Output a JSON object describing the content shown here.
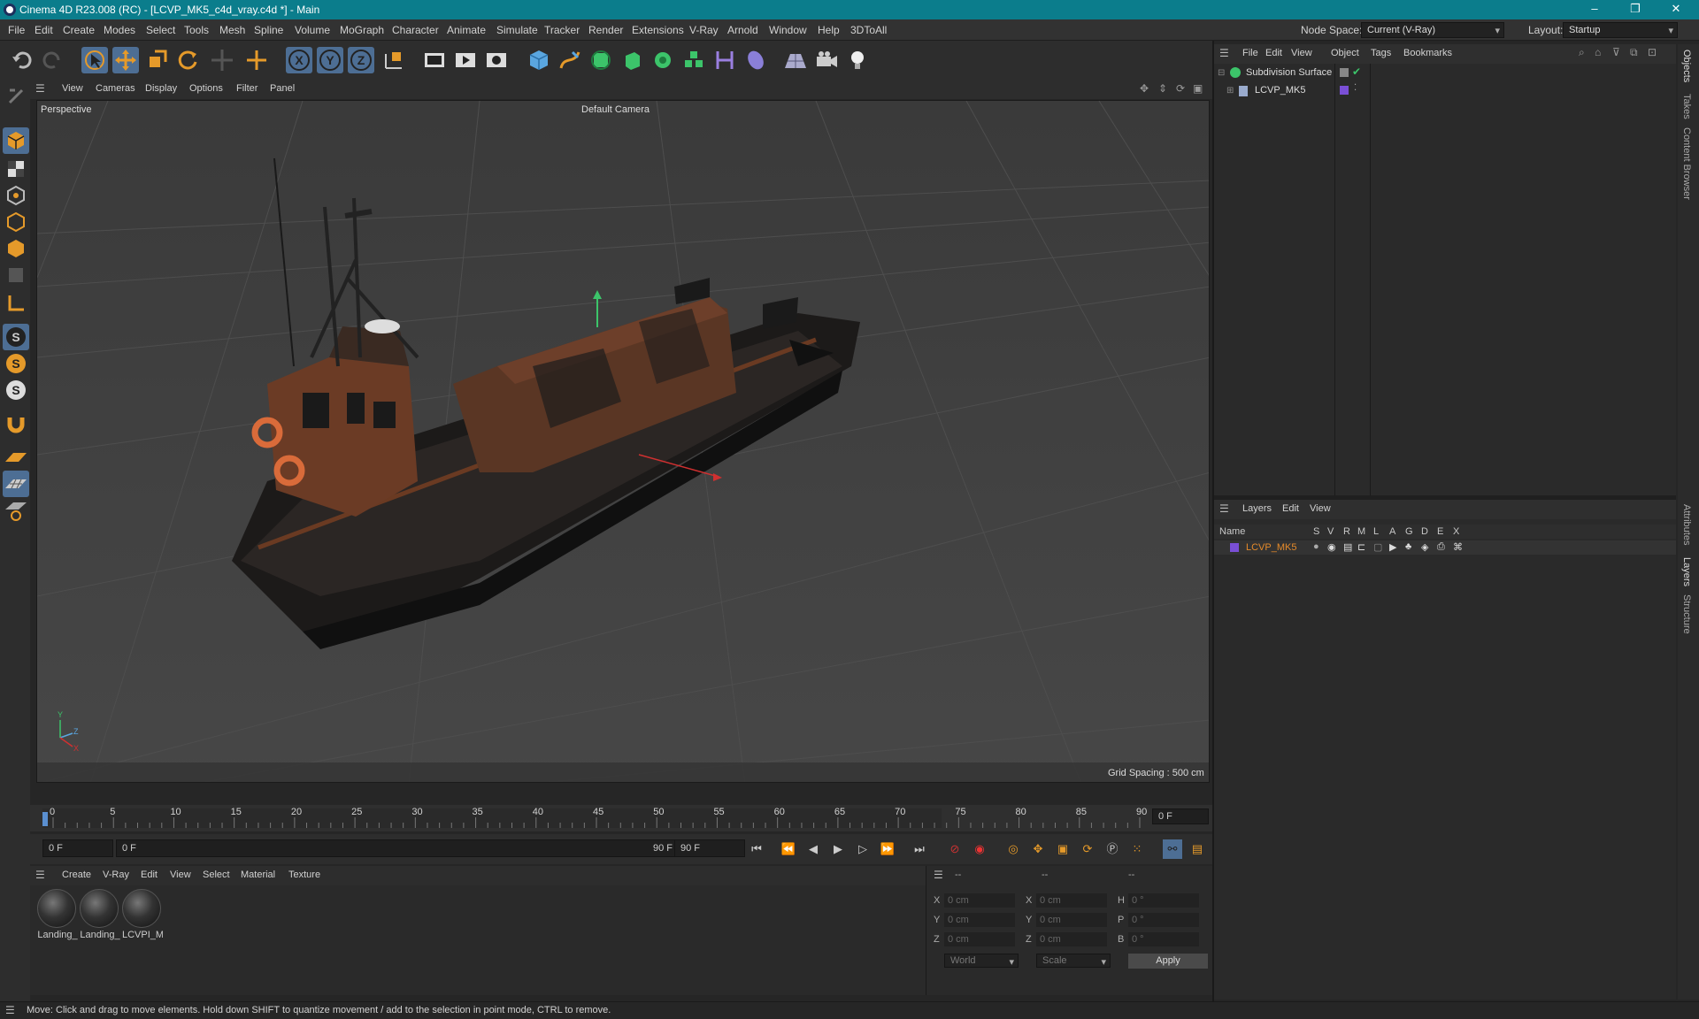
{
  "window": {
    "title": "Cinema 4D R23.008 (RC) - [LCVP_MK5_c4d_vray.c4d *] - Main"
  },
  "menu": [
    "File",
    "Edit",
    "Create",
    "Modes",
    "Select",
    "Tools",
    "Mesh",
    "Spline",
    "Volume",
    "MoGraph",
    "Character",
    "Animate",
    "Simulate",
    "Tracker",
    "Render",
    "Extensions",
    "V-Ray",
    "Arnold",
    "Window",
    "Help",
    "3DToAll"
  ],
  "node_space": {
    "label": "Node Space:",
    "value": "Current (V-Ray)"
  },
  "layout": {
    "label": "Layout:",
    "value": "Startup"
  },
  "viewport": {
    "menu": [
      "View",
      "Cameras",
      "Display",
      "Options",
      "Filter",
      "Panel"
    ],
    "name": "Perspective",
    "camera": "Default Camera",
    "grid_spacing": "Grid Spacing : 500 cm"
  },
  "timeline": {
    "ticks": [
      "0",
      "5",
      "10",
      "15",
      "20",
      "25",
      "30",
      "35",
      "40",
      "45",
      "50",
      "55",
      "60",
      "65",
      "70",
      "75",
      "80",
      "85",
      "90"
    ],
    "current_frame": "0 F",
    "start_field": "0 F",
    "range_start": "0 F",
    "range_end": "90 F",
    "end_field": "90 F"
  },
  "material_manager": {
    "menu": [
      "Create",
      "V-Ray",
      "Edit",
      "View",
      "Select",
      "Material",
      "Texture"
    ],
    "materials": [
      "Landing_",
      "Landing_",
      "LCVPI_M"
    ]
  },
  "coordinates": {
    "headers": [
      "--",
      "--",
      "--"
    ],
    "rows": [
      {
        "a": "X",
        "av": "0 cm",
        "b": "X",
        "bv": "0 cm",
        "c": "H",
        "cv": "0 °"
      },
      {
        "a": "Y",
        "av": "0 cm",
        "b": "Y",
        "bv": "0 cm",
        "c": "P",
        "cv": "0 °"
      },
      {
        "a": "Z",
        "av": "0 cm",
        "b": "Z",
        "bv": "0 cm",
        "c": "B",
        "cv": "0 °"
      }
    ],
    "space": "World",
    "mode": "Scale",
    "apply": "Apply"
  },
  "object_manager": {
    "menu": [
      "File",
      "Edit",
      "View",
      "Object",
      "Tags",
      "Bookmarks"
    ],
    "objects": [
      {
        "name": "Subdivision Surface",
        "indent": 0
      },
      {
        "name": "LCVP_MK5",
        "indent": 1
      }
    ]
  },
  "layer_manager": {
    "menu": [
      "Layers",
      "Edit",
      "View"
    ],
    "columns": [
      "Name",
      "S",
      "V",
      "R",
      "M",
      "L",
      "A",
      "G",
      "D",
      "E",
      "X"
    ],
    "layers": [
      {
        "name": "LCVP_MK5",
        "color": "#7a4fd6"
      }
    ]
  },
  "right_tabs": [
    "Objects",
    "Takes",
    "Content Browser",
    "Attributes",
    "Layers",
    "Structure"
  ],
  "status": "Move: Click and drag to move elements. Hold down SHIFT to quantize movement / add to the selection in point mode, CTRL to remove.",
  "colors": {
    "title_bar": "#0b7d8c",
    "accent_orange": "#e59a2a",
    "selected_blue": "#4d6e94",
    "layer_text": "#e58a2a"
  }
}
